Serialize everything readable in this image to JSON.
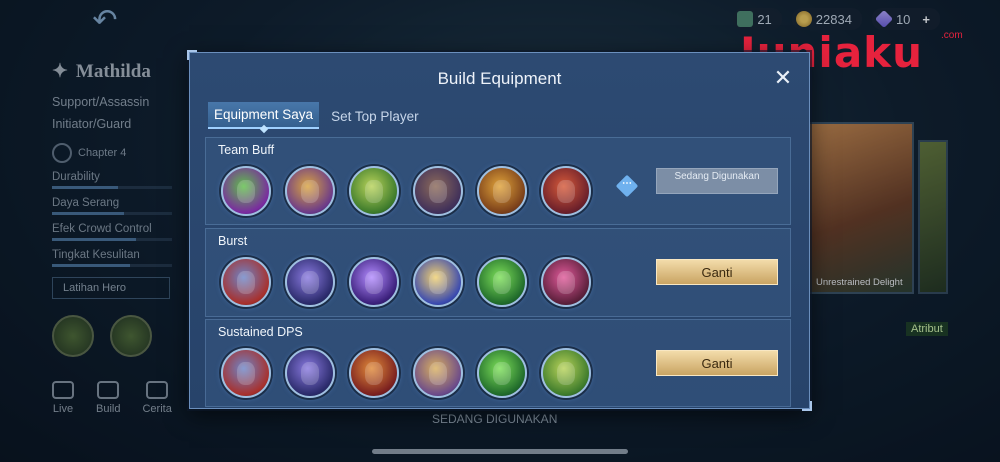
{
  "background": {
    "hero": {
      "name": "Mathilda",
      "roles": [
        "Support/Assassin",
        "Initiator/Guard"
      ],
      "chapter": "Chapter 4",
      "stats": [
        {
          "label": "Durability",
          "level": 0.55
        },
        {
          "label": "Daya Serang",
          "level": 0.6
        },
        {
          "label": "Efek Crowd Control",
          "level": 0.7
        },
        {
          "label": "Tingkat Kesulitan",
          "level": 0.65
        }
      ],
      "latihan_label": "Latihan Hero"
    },
    "resources": [
      {
        "icon": "ticket-icon",
        "value": "21"
      },
      {
        "icon": "coin-icon",
        "value": "22834"
      },
      {
        "icon": "diamond-icon",
        "value": "10"
      }
    ],
    "bottom_nav": [
      "Live",
      "Build",
      "Cerita"
    ],
    "skin_name": "Unrestrained Delight",
    "atribut_label": "Atribut",
    "sedang_digunakan_label": "SEDANG DIGUNAKAN",
    "watermark": "Juniaku",
    "watermark_suffix": ".com"
  },
  "modal": {
    "title": "Build Equipment",
    "tabs": [
      "Equipment Saya",
      "Set Top Player"
    ],
    "sections": [
      {
        "title": "Team Buff",
        "action": "Sedang Digunakan",
        "items": [
          {
            "icon": "boots-item-icon",
            "colors": [
              "#5fbf4a",
              "#7a2aa0"
            ]
          },
          {
            "icon": "shield-item-icon",
            "colors": [
              "#d9a441",
              "#6b3a8a"
            ]
          },
          {
            "icon": "lantern-item-icon",
            "colors": [
              "#b8d35a",
              "#3c7a2b"
            ]
          },
          {
            "icon": "helmet-item-icon",
            "colors": [
              "#8c6a5a",
              "#40305a"
            ]
          },
          {
            "icon": "guard-item-icon",
            "colors": [
              "#e0a33a",
              "#7a3f1a"
            ]
          },
          {
            "icon": "armor-item-icon",
            "colors": [
              "#d65a3a",
              "#6a1f2a"
            ]
          }
        ]
      },
      {
        "title": "Burst",
        "action": "Ganti",
        "items": [
          {
            "icon": "book-item-icon",
            "colors": [
              "#6e86c8",
              "#a8302c"
            ]
          },
          {
            "icon": "magic-boots-item-icon",
            "colors": [
              "#8a7ae0",
              "#2a2a6a"
            ]
          },
          {
            "icon": "crossed-wands-item-icon",
            "colors": [
              "#b38cff",
              "#3a1f7a"
            ]
          },
          {
            "icon": "wand-item-icon",
            "colors": [
              "#f0d070",
              "#3a4ab0"
            ]
          },
          {
            "icon": "crystal-item-icon",
            "colors": [
              "#7ee05a",
              "#1f6a2a"
            ]
          },
          {
            "icon": "scythe-item-icon",
            "colors": [
              "#e05a9a",
              "#5a1f3a"
            ]
          }
        ]
      },
      {
        "title": "Sustained DPS",
        "action": "Ganti",
        "items": [
          {
            "icon": "book-item-icon",
            "colors": [
              "#6e86c8",
              "#a8302c"
            ]
          },
          {
            "icon": "magic-boots-item-icon",
            "colors": [
              "#8a7ae0",
              "#2a2a6a"
            ]
          },
          {
            "icon": "lightning-item-icon",
            "colors": [
              "#e08a3a",
              "#7a1f1f"
            ]
          },
          {
            "icon": "shield-item-icon",
            "colors": [
              "#d9b060",
              "#6b4a8a"
            ]
          },
          {
            "icon": "crystal-item-icon",
            "colors": [
              "#7ee05a",
              "#1f6a2a"
            ]
          },
          {
            "icon": "lantern-item-icon",
            "colors": [
              "#b8d35a",
              "#3c7a2b"
            ]
          }
        ]
      }
    ]
  }
}
